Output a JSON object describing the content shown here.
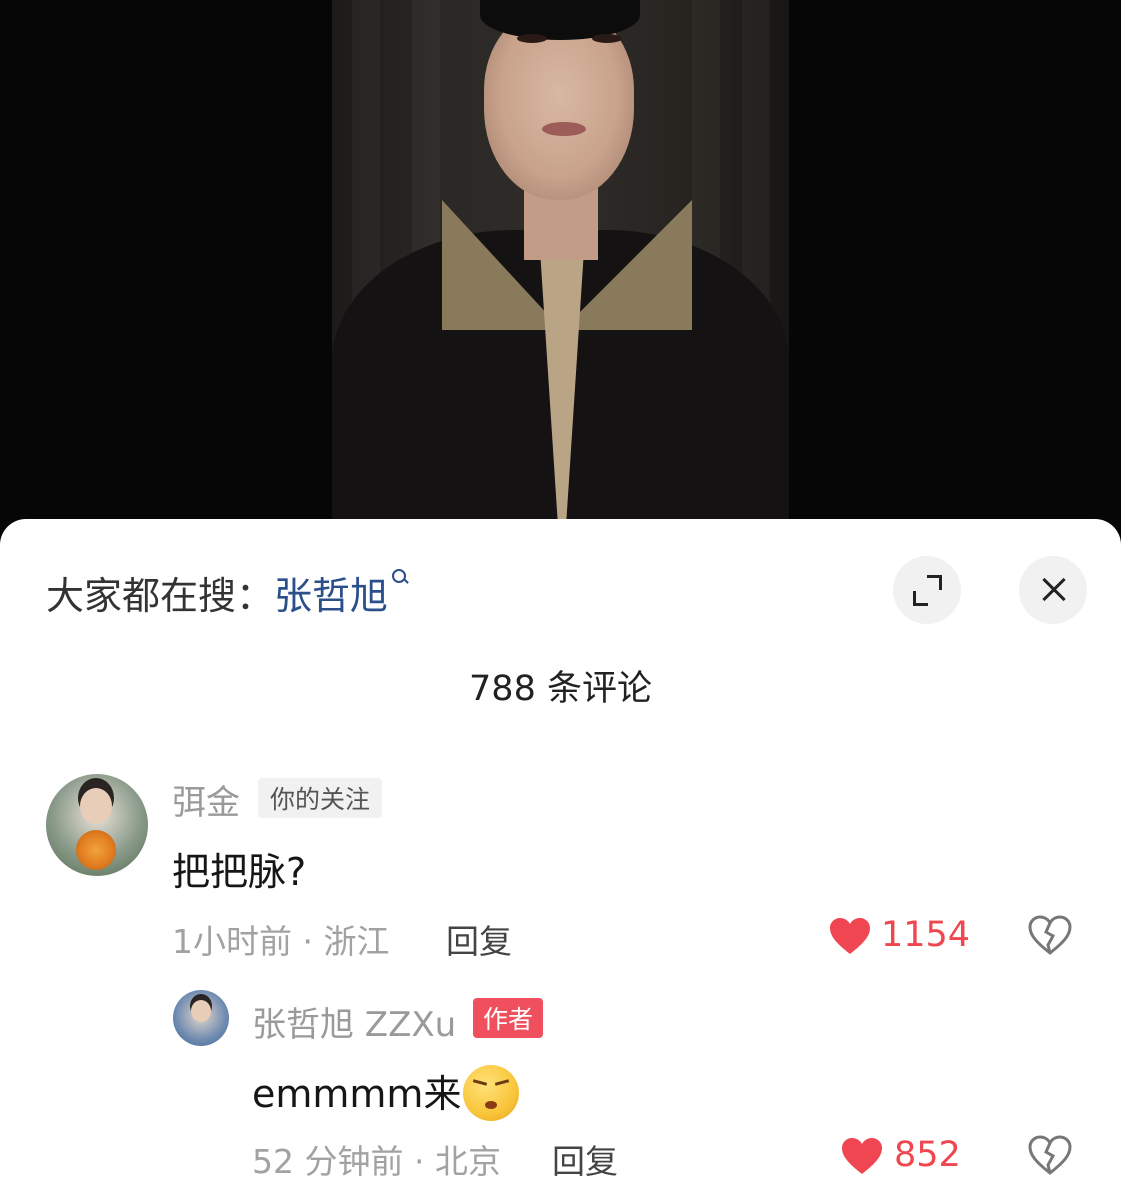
{
  "search_hint": {
    "prefix": "大家都在搜：",
    "keyword": "张哲旭"
  },
  "comments_count_label": "788 条评论",
  "comments": [
    {
      "author": "弭金",
      "tag": "你的关注",
      "text": "把把脉?",
      "time_location": "1小时前 · 浙江",
      "reply_label": "回复",
      "likes": "1154"
    },
    {
      "author": "张哲旭 ZZXu",
      "tag": "作者",
      "text": "emmmm来",
      "emoji": "unamused-face-emoji",
      "time_location": "52 分钟前 · 北京",
      "reply_label": "回复",
      "likes": "852"
    }
  ],
  "icons": {
    "search": "search-icon",
    "expand": "expand-icon",
    "close": "close-icon",
    "like": "heart-icon",
    "dislike": "broken-heart-icon"
  },
  "colors": {
    "like": "#f04651",
    "author_tag": "#f04f5e",
    "search_keyword": "#2a4f8a"
  }
}
